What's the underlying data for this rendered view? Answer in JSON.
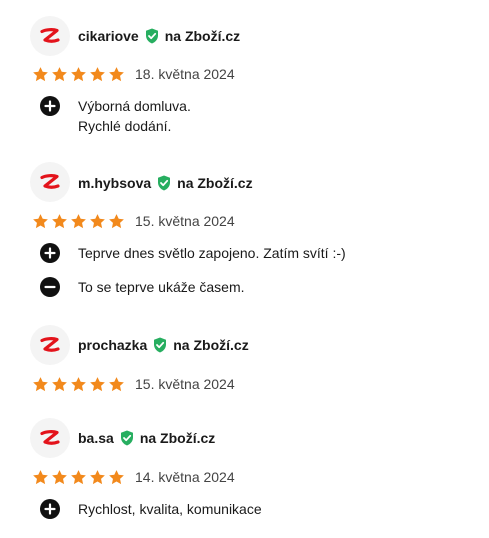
{
  "colors": {
    "star": "#f2891c",
    "verified_badge": "#27ae60",
    "logo": "#e3131b",
    "avatar_bg": "#f4f4f4",
    "point_icon": "#111111"
  },
  "icons": {
    "avatar": "zbozi-logo-icon",
    "verified": "verified-shield-icon",
    "star": "star-icon",
    "pro": "plus-circle-icon",
    "con": "minus-circle-icon"
  },
  "reviews": [
    {
      "author": "cikariove",
      "source": "na Zboží.cz",
      "rating": 5,
      "date": "18. května 2024",
      "pros": [
        [
          "Výborná domluva.",
          "Rychlé dodání."
        ]
      ],
      "cons": []
    },
    {
      "author": "m.hybsova",
      "source": "na Zboží.cz",
      "rating": 5,
      "date": "15. května 2024",
      "pros": [
        [
          "Teprve dnes světlo zapojeno. Zatím svítí :-)"
        ]
      ],
      "cons": [
        [
          "To se teprve ukáže časem."
        ]
      ]
    },
    {
      "author": "prochazka",
      "source": "na Zboží.cz",
      "rating": 5,
      "date": "15. května 2024",
      "pros": [],
      "cons": []
    },
    {
      "author": "ba.sa",
      "source": "na Zboží.cz",
      "rating": 5,
      "date": "14. května 2024",
      "pros": [
        [
          "Rychlost, kvalita, komunikace"
        ]
      ],
      "cons": []
    }
  ]
}
